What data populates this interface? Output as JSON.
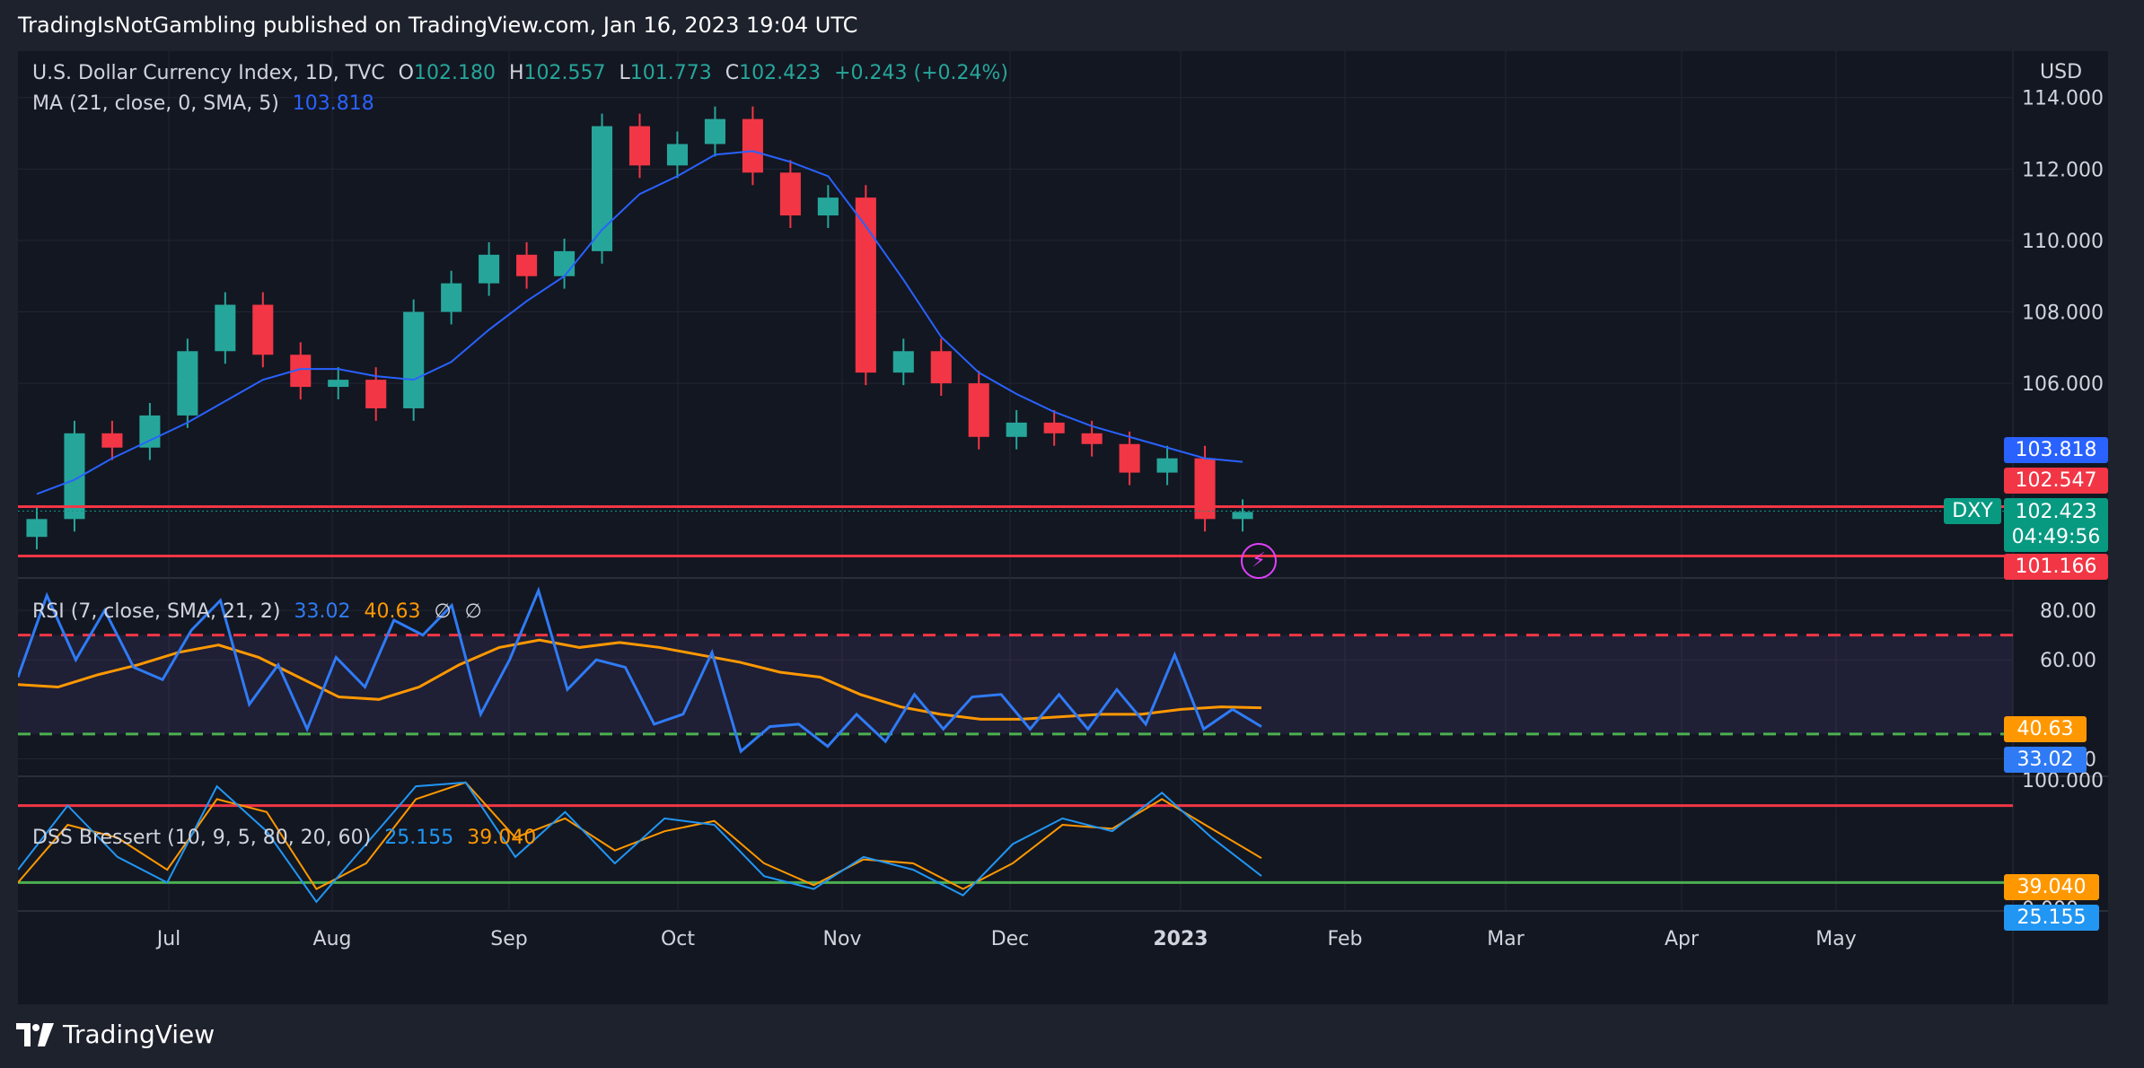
{
  "header": {
    "text": "TradingIsNotGambling published on TradingView.com, Jan 16, 2023 19:04 UTC"
  },
  "footer": {
    "brand": "TradingView"
  },
  "colors": {
    "up": "#26a69a",
    "down": "#f23645",
    "ma": "#2962ff",
    "rsi": "#2f7bf5",
    "rsi_ma": "#ff9800",
    "dss_k": "#2196f3",
    "dss_d": "#ff9800",
    "bg": "#131722"
  },
  "main_legend": {
    "symbol": "U.S. Dollar Currency Index, 1D, TVC",
    "o_label": "O",
    "o": "102.180",
    "h_label": "H",
    "h": "102.557",
    "l_label": "L",
    "l": "101.773",
    "c_label": "C",
    "c": "102.423",
    "change": "+0.243 (+0.24%)",
    "ma_label": "MA (21, close, 0, SMA, 5)",
    "ma_value": "103.818"
  },
  "rsi_legend": {
    "label": "RSI (7, close, SMA, 21, 2)",
    "rsi": "33.02",
    "ma": "40.63",
    "na1": "∅",
    "na2": "∅"
  },
  "dss_legend": {
    "label": "DSS Bressert (10, 9, 5, 80, 20, 60)",
    "k": "25.155",
    "d": "39.040"
  },
  "price_axis": {
    "unit": "USD",
    "ticks": [
      "114.000",
      "112.000",
      "110.000",
      "108.000",
      "106.000"
    ]
  },
  "price_badges": {
    "ma": "103.818",
    "upper_line": "102.547",
    "symbol": "DXY",
    "last": "102.423",
    "countdown": "04:49:56",
    "lower_line": "101.166"
  },
  "rsi_axis": {
    "ticks": [
      "80.00",
      "60.00",
      "20.00"
    ],
    "badge_ma": "40.63",
    "badge_rsi": "33.02"
  },
  "dss_axis": {
    "ticks": [
      "100.000",
      "0.000"
    ],
    "badge_d": "39.040",
    "badge_k": "25.155"
  },
  "time_axis": {
    "labels": [
      "Jul",
      "Aug",
      "Sep",
      "Oct",
      "Nov",
      "Dec",
      "2023",
      "Feb",
      "Mar",
      "Apr",
      "May"
    ]
  },
  "chart_data": {
    "type": "candlestick",
    "symbol": "DXY",
    "timeframe": "1D",
    "ylim": [
      100.6,
      115.3
    ],
    "horizontal_lines": [
      102.547,
      101.166
    ],
    "x": [
      "2022-06-06",
      "2022-06-13",
      "2022-06-20",
      "2022-06-27",
      "2022-07-04",
      "2022-07-11",
      "2022-07-18",
      "2022-07-25",
      "2022-08-01",
      "2022-08-08",
      "2022-08-15",
      "2022-08-22",
      "2022-08-29",
      "2022-09-05",
      "2022-09-12",
      "2022-09-19",
      "2022-09-26",
      "2022-10-03",
      "2022-10-10",
      "2022-10-17",
      "2022-10-24",
      "2022-10-31",
      "2022-11-07",
      "2022-11-14",
      "2022-11-21",
      "2022-11-28",
      "2022-12-05",
      "2022-12-12",
      "2022-12-19",
      "2022-12-26",
      "2023-01-02",
      "2023-01-09",
      "2023-01-16"
    ],
    "close": [
      102.2,
      104.6,
      104.2,
      105.1,
      106.9,
      108.2,
      106.8,
      105.9,
      106.1,
      105.3,
      108.0,
      108.8,
      109.6,
      109.0,
      109.7,
      113.2,
      112.1,
      112.7,
      113.4,
      111.9,
      110.7,
      111.2,
      106.3,
      106.9,
      106.0,
      104.5,
      104.9,
      104.6,
      104.3,
      103.5,
      103.9,
      102.2,
      102.4
    ],
    "series": [
      {
        "name": "MA (21, close, 0, SMA, 5)",
        "values": [
          102.9,
          103.3,
          103.9,
          104.4,
          104.9,
          105.5,
          106.1,
          106.4,
          106.4,
          106.2,
          106.1,
          106.6,
          107.5,
          108.3,
          109.0,
          110.3,
          111.3,
          111.8,
          112.4,
          112.5,
          112.2,
          111.8,
          110.4,
          108.9,
          107.3,
          106.3,
          105.7,
          105.2,
          104.8,
          104.5,
          104.2,
          103.9,
          103.8
        ]
      }
    ],
    "rsi": {
      "name": "RSI (7, close, SMA, 21, 2)",
      "ylim": [
        14,
        92
      ],
      "levels": [
        70,
        30
      ],
      "values": [
        53,
        86,
        60,
        80,
        57,
        52,
        72,
        84,
        42,
        58,
        32,
        61,
        49,
        76,
        70,
        82,
        38,
        60,
        88,
        48,
        60,
        57,
        34,
        38,
        63,
        23,
        33,
        34,
        25,
        38,
        27,
        46,
        32,
        45,
        46,
        32,
        46,
        32,
        48,
        34,
        62,
        32,
        40,
        33
      ],
      "ma_values": [
        50,
        49,
        54,
        58,
        63,
        66,
        61,
        53,
        45,
        44,
        49,
        58,
        65,
        68,
        65,
        67,
        65,
        62,
        59,
        55,
        53,
        46,
        41,
        38,
        36,
        36,
        37,
        38,
        38,
        40,
        41,
        40.6
      ]
    },
    "dss": {
      "name": "DSS Bressert (10, 9, 5, 80, 20, 60)",
      "ylim": [
        0,
        100
      ],
      "levels": [
        80,
        20
      ],
      "k_values": [
        30,
        80,
        40,
        20,
        95,
        60,
        5,
        50,
        95,
        98,
        40,
        75,
        35,
        70,
        65,
        25,
        15,
        40,
        30,
        10,
        50,
        70,
        60,
        90,
        55,
        25.155
      ],
      "d_values": [
        20,
        65,
        55,
        30,
        85,
        75,
        15,
        35,
        85,
        98,
        55,
        70,
        45,
        60,
        68,
        35,
        18,
        38,
        35,
        15,
        35,
        65,
        62,
        85,
        62,
        39.04
      ]
    }
  }
}
